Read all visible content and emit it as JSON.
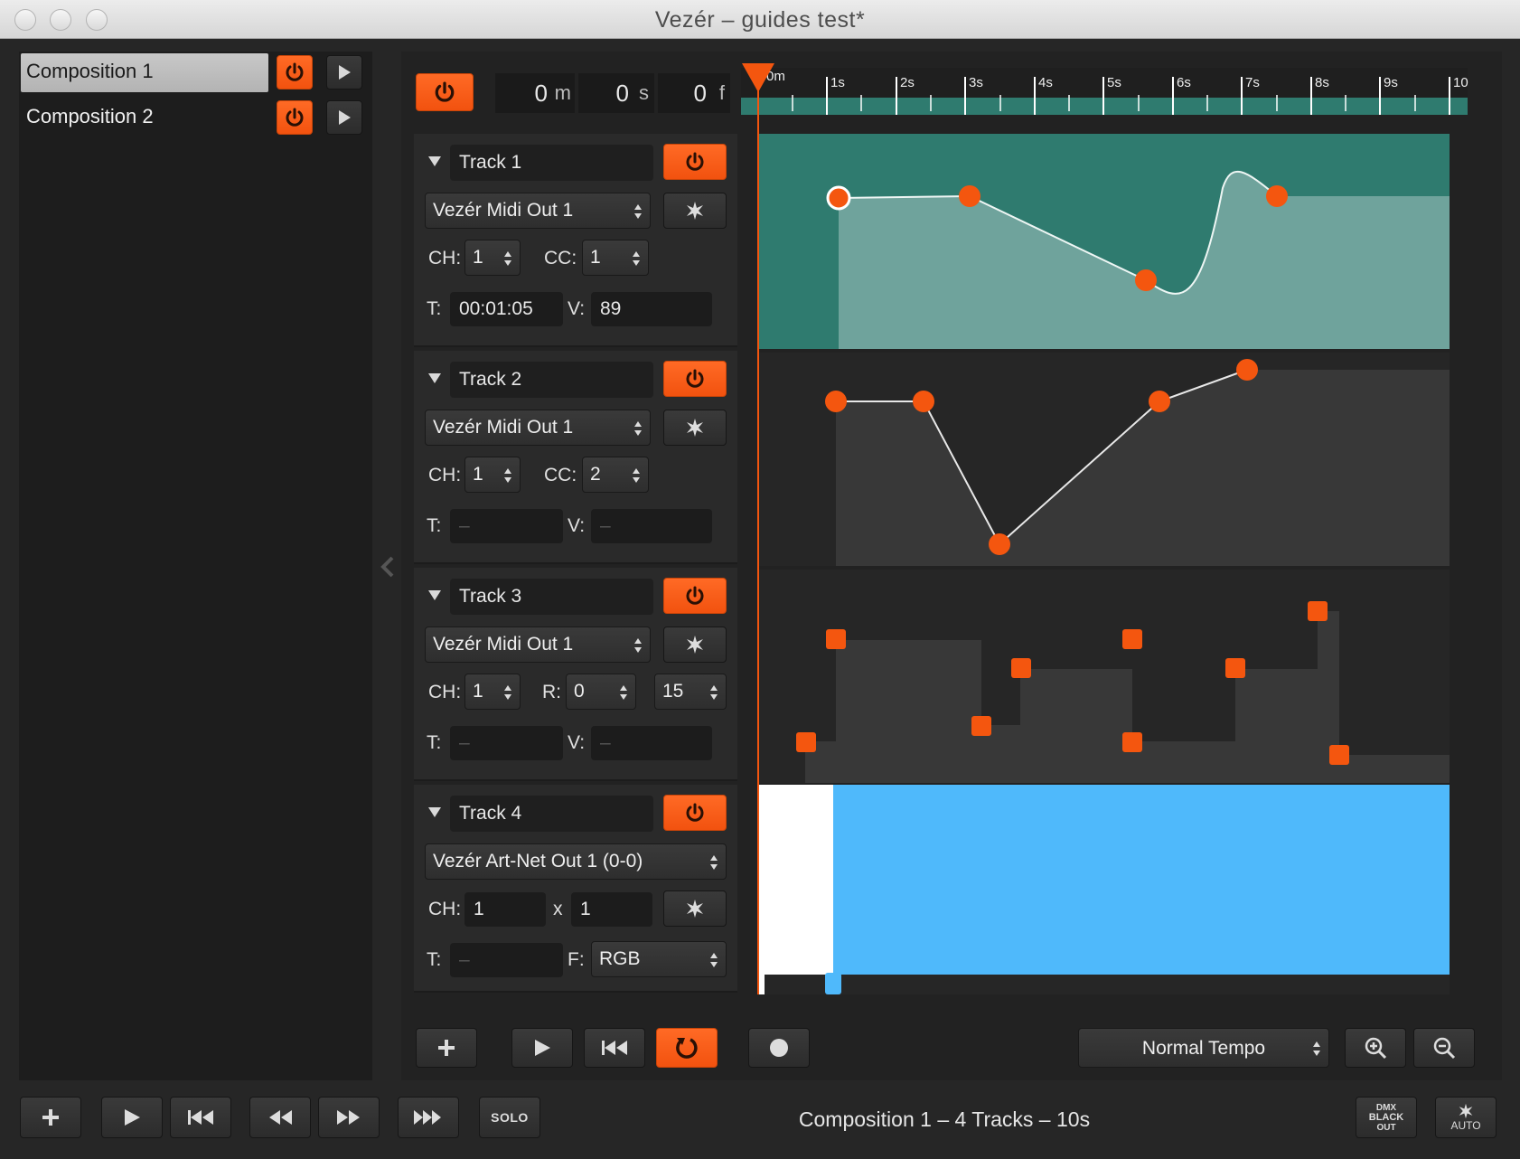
{
  "window": {
    "title": "Vezér – guides test*"
  },
  "compositions": [
    {
      "name": "Composition 1",
      "selected": true
    },
    {
      "name": "Composition 2",
      "selected": false
    }
  ],
  "time": {
    "minutes": "0",
    "m": "m",
    "seconds": "0",
    "s": "s",
    "frames": "0",
    "f": "f"
  },
  "ruler": {
    "labels": [
      "0m",
      "1s",
      "2s",
      "3s",
      "4s",
      "5s",
      "6s",
      "7s",
      "8s",
      "9s",
      "10"
    ]
  },
  "tracks": [
    {
      "name": "Track 1",
      "output": "Vezér Midi Out 1",
      "ch_label": "CH:",
      "ch": "1",
      "p2_label": "CC:",
      "p2": "1",
      "t_label": "T:",
      "t": "00:01:05",
      "v_label": "V:",
      "v": "89"
    },
    {
      "name": "Track 2",
      "output": "Vezér Midi Out 1",
      "ch_label": "CH:",
      "ch": "1",
      "p2_label": "CC:",
      "p2": "2",
      "t_label": "T:",
      "t": "–",
      "v_label": "V:",
      "v": "–"
    },
    {
      "name": "Track 3",
      "output": "Vezér Midi Out 1",
      "ch_label": "CH:",
      "ch": "1",
      "p2_label": "R:",
      "p2": "0",
      "p3": "15",
      "t_label": "T:",
      "t": "–",
      "v_label": "V:",
      "v": "–"
    },
    {
      "name": "Track 4",
      "output": "Vezér Art-Net Out 1 (0-0)",
      "ch_label": "CH:",
      "ch": "1",
      "x_label": "x",
      "x": "1",
      "t_label": "T:",
      "t": "–",
      "f_label": "F:",
      "f": "RGB"
    }
  ],
  "tempo": {
    "selected": "Normal Tempo"
  },
  "bottom": {
    "solo_label": "SOLO",
    "status": "Composition 1 – 4 Tracks – 10s",
    "dmx_line1": "DMX",
    "dmx_line2": "BLACK",
    "dmx_line3": "OUT",
    "auto_label": "AUTO"
  },
  "colors": {
    "accent": "#f4560f",
    "teal": "#2f7b6f",
    "teal_light": "#6fa39c",
    "blue": "#4fb9fb",
    "dark_fill": "#383838"
  }
}
